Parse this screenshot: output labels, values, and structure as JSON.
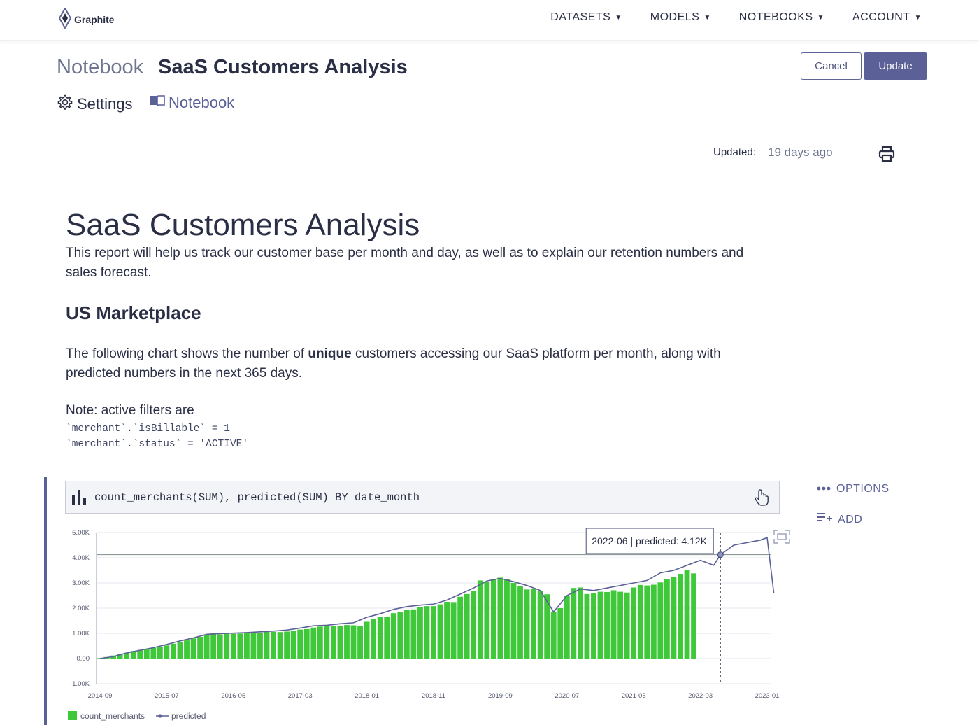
{
  "app": {
    "logo_text": "Graphite"
  },
  "nav": {
    "items": [
      {
        "label": "DATASETS"
      },
      {
        "label": "MODELS"
      },
      {
        "label": "NOTEBOOKS"
      },
      {
        "label": "ACCOUNT"
      }
    ]
  },
  "header": {
    "crumb_root": "Notebook",
    "title": "SaaS Customers Analysis",
    "cancel_label": "Cancel",
    "update_label": "Update"
  },
  "tabs": {
    "settings": "Settings",
    "notebook": "Notebook"
  },
  "meta": {
    "updated_label": "Updated:",
    "updated_value": "19 days ago"
  },
  "doc": {
    "title": "SaaS Customers Analysis",
    "description": "This report will help us track our customer base per month and day, as well as to explain our retention numbers and sales forecast.",
    "section_heading": "US Marketplace",
    "para_prefix": "The following chart shows the number of ",
    "para_bold": "unique",
    "para_suffix": " customers accessing our SaaS platform per month, along with predicted numbers in the next 365 days.",
    "note": "Note: active filters are",
    "filters": [
      "`merchant`.`isBillable` = 1",
      "`merchant`.`status` = 'ACTIVE'"
    ]
  },
  "cell": {
    "query": "count_merchants(SUM), predicted(SUM) BY date_month",
    "options_label": "OPTIONS",
    "add_label": "ADD"
  },
  "colors": {
    "accent": "#5b6197",
    "bar": "#3fc83a",
    "line": "#5b6197"
  },
  "chart_data": {
    "type": "bar",
    "y_tick_labels": [
      "5.00K",
      "4.00K",
      "3.00K",
      "2.00K",
      "1.00K",
      "0.00",
      "-1.00K"
    ],
    "ylim": [
      -1000,
      5000
    ],
    "x_tick_labels": [
      "2014-09",
      "2015-07",
      "2016-05",
      "2017-03",
      "2018-01",
      "2018-11",
      "2019-09",
      "2020-07",
      "2021-05",
      "2022-03",
      "2023-01"
    ],
    "tooltip": "2022-06 | predicted: 4.12K",
    "hover_month": "2022-06",
    "hover_value": 4120,
    "grid": true,
    "legend_position": "bottom-left",
    "series": [
      {
        "name": "count_merchants",
        "style": "bar",
        "x": [
          "2014-09",
          "2014-10",
          "2014-11",
          "2014-12",
          "2015-01",
          "2015-02",
          "2015-03",
          "2015-04",
          "2015-05",
          "2015-06",
          "2015-07",
          "2015-08",
          "2015-09",
          "2015-10",
          "2015-11",
          "2015-12",
          "2016-01",
          "2016-02",
          "2016-03",
          "2016-04",
          "2016-05",
          "2016-06",
          "2016-07",
          "2016-08",
          "2016-09",
          "2016-10",
          "2016-11",
          "2016-12",
          "2017-01",
          "2017-02",
          "2017-03",
          "2017-04",
          "2017-05",
          "2017-06",
          "2017-07",
          "2017-08",
          "2017-09",
          "2017-10",
          "2017-11",
          "2017-12",
          "2018-01",
          "2018-02",
          "2018-03",
          "2018-04",
          "2018-05",
          "2018-06",
          "2018-07",
          "2018-08",
          "2018-09",
          "2018-10",
          "2018-11",
          "2018-12",
          "2019-01",
          "2019-02",
          "2019-03",
          "2019-04",
          "2019-05",
          "2019-06",
          "2019-07",
          "2019-08",
          "2019-09",
          "2019-10",
          "2019-11",
          "2019-12",
          "2020-01",
          "2020-02",
          "2020-03",
          "2020-04",
          "2020-05",
          "2020-06",
          "2020-07",
          "2020-08",
          "2020-09",
          "2020-10",
          "2020-11",
          "2020-12",
          "2021-01",
          "2021-02",
          "2021-03",
          "2021-04",
          "2021-05",
          "2021-06",
          "2021-07",
          "2021-08",
          "2021-09",
          "2021-10",
          "2021-11",
          "2021-12",
          "2022-01",
          "2022-02"
        ],
        "values": [
          20,
          60,
          120,
          180,
          230,
          300,
          340,
          380,
          420,
          470,
          520,
          590,
          650,
          720,
          800,
          860,
          960,
          1010,
          960,
          1010,
          980,
          990,
          1020,
          1040,
          1030,
          1070,
          1060,
          1050,
          1070,
          1110,
          1150,
          1170,
          1230,
          1270,
          1290,
          1280,
          1300,
          1330,
          1320,
          1290,
          1460,
          1570,
          1650,
          1640,
          1800,
          1860,
          1920,
          1950,
          2050,
          2080,
          2080,
          2150,
          2250,
          2240,
          2450,
          2560,
          2680,
          3100,
          3050,
          3150,
          3210,
          3150,
          3000,
          2860,
          2740,
          2750,
          2680,
          2550,
          1850,
          2000,
          2500,
          2800,
          2820,
          2560,
          2600,
          2650,
          2640,
          2710,
          2650,
          2620,
          2820,
          2920,
          2900,
          2930,
          3020,
          3160,
          3230,
          3360,
          3500,
          3380
        ]
      },
      {
        "name": "predicted",
        "style": "line",
        "x": [
          "2014-09",
          "2014-11",
          "2015-01",
          "2015-03",
          "2015-05",
          "2015-07",
          "2015-09",
          "2015-11",
          "2016-01",
          "2016-03",
          "2016-05",
          "2016-07",
          "2016-09",
          "2016-11",
          "2017-01",
          "2017-03",
          "2017-05",
          "2017-07",
          "2017-09",
          "2017-11",
          "2018-01",
          "2018-03",
          "2018-05",
          "2018-07",
          "2018-09",
          "2018-11",
          "2019-01",
          "2019-03",
          "2019-05",
          "2019-07",
          "2019-09",
          "2019-11",
          "2020-01",
          "2020-03",
          "2020-05",
          "2020-07",
          "2020-09",
          "2020-11",
          "2021-01",
          "2021-03",
          "2021-05",
          "2021-07",
          "2021-09",
          "2021-11",
          "2022-01",
          "2022-03",
          "2022-05",
          "2022-06",
          "2022-08",
          "2022-10",
          "2022-12",
          "2023-01",
          "2023-02"
        ],
        "values": [
          0,
          80,
          220,
          330,
          430,
          560,
          700,
          820,
          960,
          990,
          1010,
          1030,
          1060,
          1090,
          1130,
          1210,
          1300,
          1320,
          1380,
          1420,
          1640,
          1780,
          1950,
          2060,
          2120,
          2160,
          2320,
          2560,
          2800,
          3080,
          3180,
          3050,
          2900,
          2700,
          1850,
          2500,
          2760,
          2700,
          2800,
          2900,
          3000,
          3100,
          3400,
          3500,
          3700,
          3900,
          3700,
          4120,
          4500,
          4600,
          4700,
          4800,
          2600
        ]
      }
    ]
  }
}
